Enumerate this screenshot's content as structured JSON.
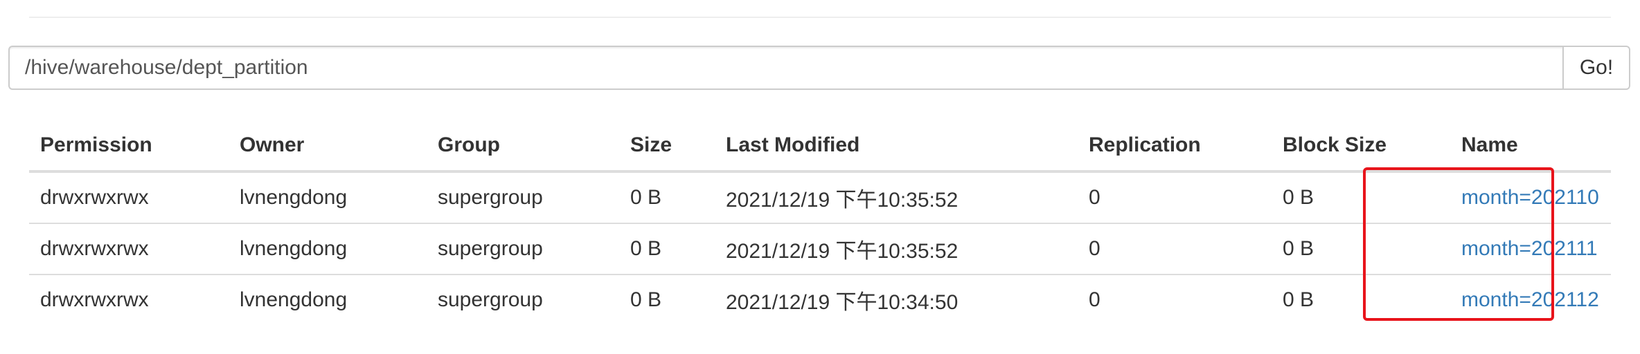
{
  "path_bar": {
    "path_value": "/hive/warehouse/dept_partition",
    "go_label": "Go!"
  },
  "table": {
    "headers": {
      "permission": "Permission",
      "owner": "Owner",
      "group": "Group",
      "size": "Size",
      "last_modified": "Last Modified",
      "replication": "Replication",
      "block_size": "Block Size",
      "name": "Name"
    },
    "rows": [
      {
        "permission": "drwxrwxrwx",
        "owner": "lvnengdong",
        "group": "supergroup",
        "size": "0 B",
        "last_modified": "2021/12/19 下午10:35:52",
        "replication": "0",
        "block_size": "0 B",
        "name": "month=202110"
      },
      {
        "permission": "drwxrwxrwx",
        "owner": "lvnengdong",
        "group": "supergroup",
        "size": "0 B",
        "last_modified": "2021/12/19 下午10:35:52",
        "replication": "0",
        "block_size": "0 B",
        "name": "month=202111"
      },
      {
        "permission": "drwxrwxrwx",
        "owner": "lvnengdong",
        "group": "supergroup",
        "size": "0 B",
        "last_modified": "2021/12/19 下午10:34:50",
        "replication": "0",
        "block_size": "0 B",
        "name": "month=202112"
      }
    ]
  },
  "colors": {
    "link": "#337ab7",
    "highlight_box": "#e8141b"
  }
}
